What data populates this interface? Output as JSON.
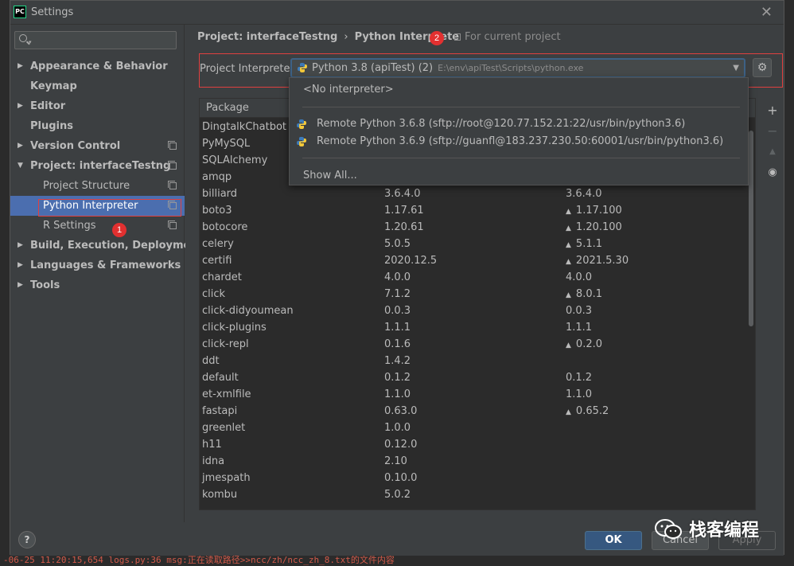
{
  "window": {
    "title": "Settings",
    "app_icon": "PC"
  },
  "sidebar": {
    "search_placeholder": "",
    "items": [
      {
        "label": "Appearance & Behavior",
        "expander": "▶",
        "bold": true
      },
      {
        "label": "Keymap",
        "expander": "",
        "bold": true
      },
      {
        "label": "Editor",
        "expander": "▶",
        "bold": true
      },
      {
        "label": "Plugins",
        "expander": "",
        "bold": true
      },
      {
        "label": "Version Control",
        "expander": "▶",
        "bold": true
      },
      {
        "label": "Project: interfaceTestng",
        "expander": "▼",
        "bold": true
      },
      {
        "label": "Project Structure",
        "expander": "",
        "bold": false
      },
      {
        "label": "Python Interpreter",
        "expander": "",
        "bold": false
      },
      {
        "label": "R Settings",
        "expander": "",
        "bold": false
      },
      {
        "label": "Build, Execution, Deployment",
        "expander": "▶",
        "bold": true
      },
      {
        "label": "Languages & Frameworks",
        "expander": "▶",
        "bold": true
      },
      {
        "label": "Tools",
        "expander": "▶",
        "bold": true
      }
    ]
  },
  "breadcrumb": {
    "project": "Project: interfaceTestng",
    "separator": "›",
    "page": "Python Interprete",
    "for_current": "For current project"
  },
  "interpreter": {
    "label": "Project Interpreter:",
    "selected_name": "Python 3.8 (apiTest) (2)",
    "selected_path": "E:\\env\\apiTest\\Scripts\\python.exe"
  },
  "dropdown": {
    "no_interpreter": "<No interpreter>",
    "options": [
      "Remote Python 3.6.8 (sftp://root@120.77.152.21:22/usr/bin/python3.6)",
      "Remote Python 3.6.9 (sftp://guanfl@183.237.230.50:60001/usr/bin/python3.6)"
    ],
    "show_all": "Show All..."
  },
  "table": {
    "headers": [
      "Package",
      "",
      ""
    ],
    "rows": [
      {
        "name": "DingtalkChatbot",
        "version": "",
        "latest": "",
        "upgrade": false
      },
      {
        "name": "PyMySQL",
        "version": "",
        "latest": "",
        "upgrade": false
      },
      {
        "name": "SQLAlchemy",
        "version": "",
        "latest": "",
        "upgrade": false
      },
      {
        "name": "amqp",
        "version": "",
        "latest": "",
        "upgrade": false
      },
      {
        "name": "billiard",
        "version": "3.6.4.0",
        "latest": "3.6.4.0",
        "upgrade": false
      },
      {
        "name": "boto3",
        "version": "1.17.61",
        "latest": "1.17.100",
        "upgrade": true
      },
      {
        "name": "botocore",
        "version": "1.20.61",
        "latest": "1.20.100",
        "upgrade": true
      },
      {
        "name": "celery",
        "version": "5.0.5",
        "latest": "5.1.1",
        "upgrade": true
      },
      {
        "name": "certifi",
        "version": "2020.12.5",
        "latest": "2021.5.30",
        "upgrade": true
      },
      {
        "name": "chardet",
        "version": "4.0.0",
        "latest": "4.0.0",
        "upgrade": false
      },
      {
        "name": "click",
        "version": "7.1.2",
        "latest": "8.0.1",
        "upgrade": true
      },
      {
        "name": "click-didyoumean",
        "version": "0.0.3",
        "latest": "0.0.3",
        "upgrade": false
      },
      {
        "name": "click-plugins",
        "version": "1.1.1",
        "latest": "1.1.1",
        "upgrade": false
      },
      {
        "name": "click-repl",
        "version": "0.1.6",
        "latest": "0.2.0",
        "upgrade": true
      },
      {
        "name": "ddt",
        "version": "1.4.2",
        "latest": "",
        "upgrade": false
      },
      {
        "name": "default",
        "version": "0.1.2",
        "latest": "0.1.2",
        "upgrade": false
      },
      {
        "name": "et-xmlfile",
        "version": "1.1.0",
        "latest": "1.1.0",
        "upgrade": false
      },
      {
        "name": "fastapi",
        "version": "0.63.0",
        "latest": "0.65.2",
        "upgrade": true
      },
      {
        "name": "greenlet",
        "version": "1.0.0",
        "latest": "",
        "upgrade": false
      },
      {
        "name": "h11",
        "version": "0.12.0",
        "latest": "",
        "upgrade": false
      },
      {
        "name": "idna",
        "version": "2.10",
        "latest": "",
        "upgrade": false
      },
      {
        "name": "jmespath",
        "version": "0.10.0",
        "latest": "",
        "upgrade": false
      },
      {
        "name": "kombu",
        "version": "5.0.2",
        "latest": "",
        "upgrade": false
      }
    ]
  },
  "tools": {
    "add": "+",
    "remove": "−",
    "upgrade": "▲",
    "show": "◉"
  },
  "footer": {
    "help": "?",
    "ok": "OK",
    "cancel": "Cancel",
    "apply": "Apply"
  },
  "badges": {
    "one": "1",
    "two": "2"
  },
  "watermark": "栈客编程",
  "bottom_log": "-06-25 11:20:15,654 logs.py:36 msg:正在读取路径>>ncc/zh/ncc_zh_8.txt的文件内容",
  "colors": {
    "selection": "#4b6eaf",
    "annotation": "#e04040",
    "ok_button": "#365880"
  }
}
